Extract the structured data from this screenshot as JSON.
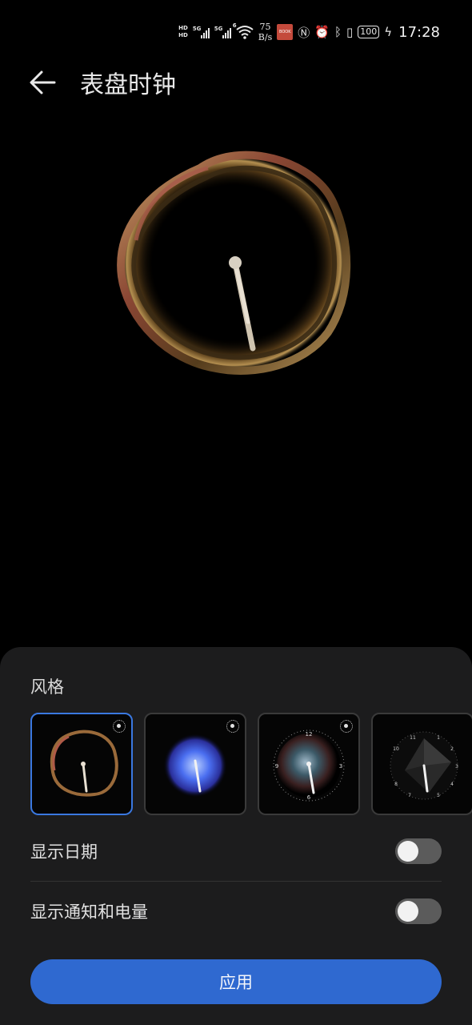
{
  "status_bar": {
    "hd1": "HD",
    "hd2": "HD",
    "sig1": "5G",
    "sig2": "5G",
    "wifi": "6",
    "speed_value": "75",
    "speed_unit": "B/s",
    "app_badge": "BOOK",
    "battery": "100",
    "time": "17:28"
  },
  "header": {
    "title": "表盘时钟"
  },
  "sheet": {
    "section_label": "风格",
    "styles": [
      {
        "name": "ring",
        "selected": true,
        "live": true
      },
      {
        "name": "blue-glow",
        "selected": false,
        "live": true
      },
      {
        "name": "nebula",
        "selected": false,
        "live": true,
        "numerals": [
          "12",
          "3",
          "6",
          "9"
        ]
      },
      {
        "name": "geometric",
        "selected": false,
        "live": false,
        "numerals": [
          "11",
          "1",
          "2",
          "3",
          "4",
          "5",
          "7",
          "8",
          "10"
        ]
      }
    ],
    "toggles": [
      {
        "label": "显示日期",
        "on": false
      },
      {
        "label": "显示通知和电量",
        "on": false
      }
    ],
    "apply_label": "应用"
  },
  "colors": {
    "accent": "#2f69d0",
    "selected_border": "#3a78e0",
    "sheet_bg": "#1c1c1d",
    "toggle_off": "#5b5b5b"
  }
}
